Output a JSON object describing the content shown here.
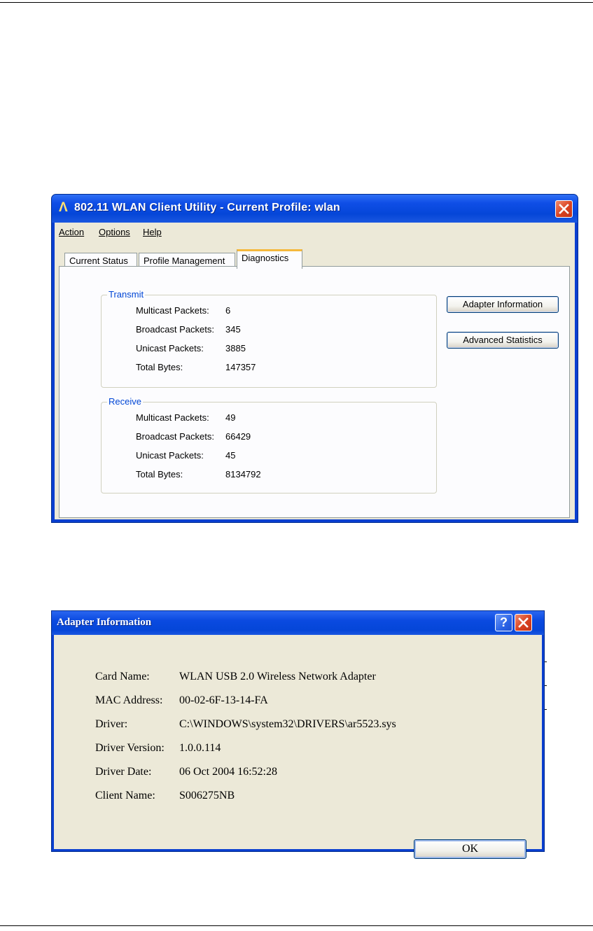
{
  "utility": {
    "title": "802.11 WLAN Client Utility - Current Profile: wlan",
    "menu": [
      "Action",
      "Options",
      "Help"
    ],
    "tabs": [
      "Current Status",
      "Profile Management",
      "Diagnostics"
    ],
    "active_tab": "Diagnostics",
    "transmit": {
      "legend": "Transmit",
      "labels": [
        "Multicast Packets:",
        "Broadcast Packets:",
        "Unicast Packets:",
        "Total Bytes:"
      ],
      "values": [
        "6",
        "345",
        "3885",
        "147357"
      ]
    },
    "receive": {
      "legend": "Receive",
      "labels": [
        "Multicast Packets:",
        "Broadcast Packets:",
        "Unicast Packets:",
        "Total Bytes:"
      ],
      "values": [
        "49",
        "66429",
        "45",
        "8134792"
      ]
    },
    "buttons": {
      "adapter_info": "Adapter Information",
      "advanced_stats": "Advanced Statistics"
    }
  },
  "adapter_dialog": {
    "title": "Adapter Information",
    "help_glyph": "?",
    "rows": [
      {
        "label": "Card Name:",
        "value": "WLAN USB 2.0 Wireless Network Adapter"
      },
      {
        "label": "MAC Address:",
        "value": "00-02-6F-13-14-FA"
      },
      {
        "label": "Driver:",
        "value": "C:\\WINDOWS\\system32\\DRIVERS\\ar5523.sys"
      },
      {
        "label": "Driver Version:",
        "value": "1.0.0.114"
      },
      {
        "label": "Driver Date:",
        "value": "06 Oct 2004 16:52:28"
      },
      {
        "label": "Client Name:",
        "value": "S006275NB"
      }
    ],
    "ok_label": "OK"
  }
}
